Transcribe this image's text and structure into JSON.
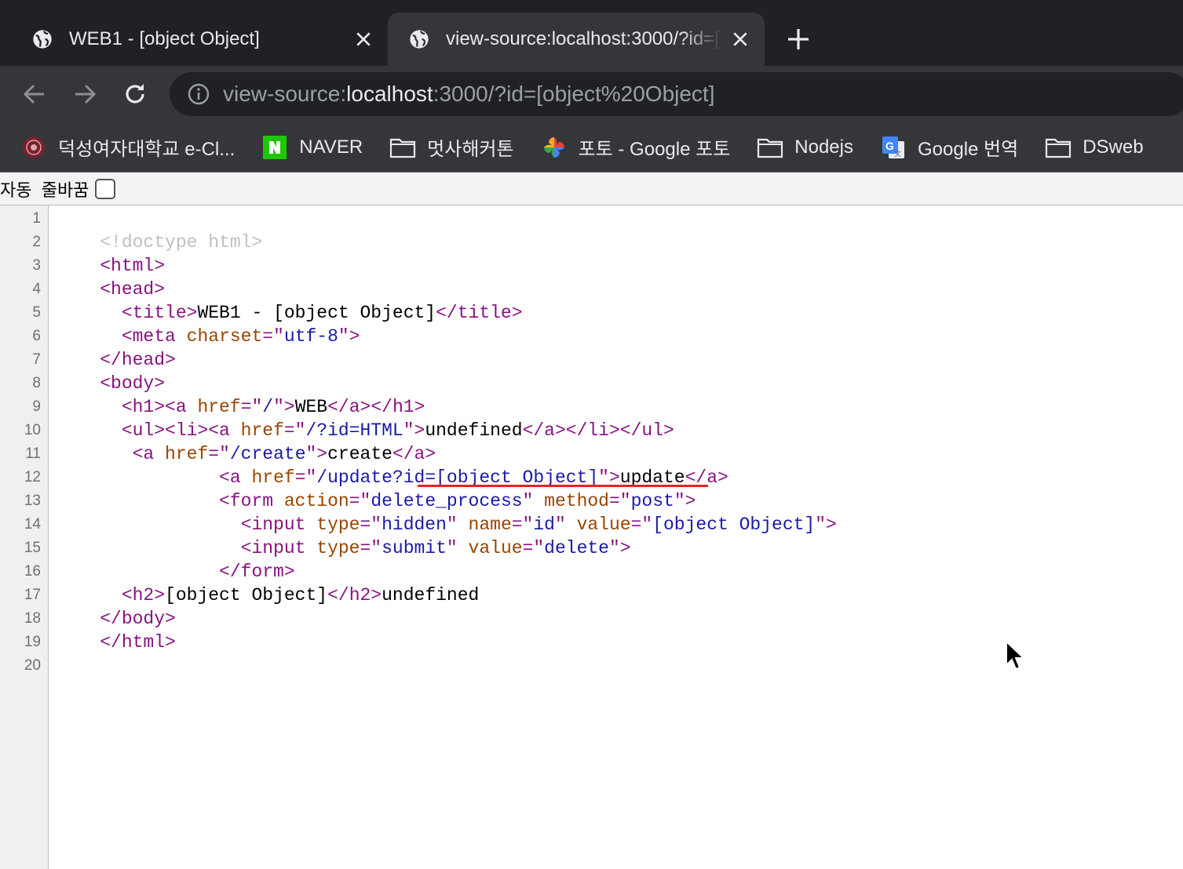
{
  "tabs": [
    {
      "title": "WEB1 - [object Object]",
      "active": false
    },
    {
      "title": "view-source:localhost:3000/?id=[object%20Object]",
      "active": true
    }
  ],
  "toolbar": {
    "url_prefix": "view-source:",
    "url_host": "localhost",
    "url_rest": ":3000/?id=[object%20Object]"
  },
  "bookmarks": [
    {
      "label": "덕성여자대학교 e-Cl...",
      "icon": "university-seal-icon"
    },
    {
      "label": "NAVER",
      "icon": "naver-icon"
    },
    {
      "label": "멋사해커톤",
      "icon": "folder-icon"
    },
    {
      "label": "포토 - Google 포토",
      "icon": "google-photos-icon"
    },
    {
      "label": "Nodejs",
      "icon": "folder-icon"
    },
    {
      "label": "Google 번역",
      "icon": "google-translate-icon"
    },
    {
      "label": "DSweb",
      "icon": "folder-icon"
    }
  ],
  "wrap": {
    "label": "자동  줄바꿈",
    "checked": false
  },
  "source": {
    "line_numbers": [
      "1",
      "2",
      "3",
      "4",
      "5",
      "6",
      "7",
      "8",
      "9",
      "10",
      "11",
      "12",
      "13",
      "14",
      "15",
      "16",
      "17",
      "18",
      "19",
      "20"
    ],
    "lines": [
      [],
      [
        [
          "doc",
          "    <!doctype html>"
        ]
      ],
      [
        [
          "txt",
          "    "
        ],
        [
          "tag",
          "<html>"
        ]
      ],
      [
        [
          "txt",
          "    "
        ],
        [
          "tag",
          "<head>"
        ]
      ],
      [
        [
          "txt",
          "      "
        ],
        [
          "tag",
          "<title>"
        ],
        [
          "txt",
          "WEB1 - [object Object]"
        ],
        [
          "tag",
          "</title>"
        ]
      ],
      [
        [
          "txt",
          "      "
        ],
        [
          "tag",
          "<meta "
        ],
        [
          "attr",
          "charset"
        ],
        [
          "tag",
          "=\""
        ],
        [
          "val",
          "utf-8"
        ],
        [
          "tag",
          "\">"
        ]
      ],
      [
        [
          "txt",
          "    "
        ],
        [
          "tag",
          "</head>"
        ]
      ],
      [
        [
          "txt",
          "    "
        ],
        [
          "tag",
          "<body>"
        ]
      ],
      [
        [
          "txt",
          "      "
        ],
        [
          "tag",
          "<h1><a "
        ],
        [
          "attr",
          "href"
        ],
        [
          "tag",
          "=\""
        ],
        [
          "val",
          "/"
        ],
        [
          "tag",
          "\">"
        ],
        [
          "txt",
          "WEB"
        ],
        [
          "tag",
          "</a></h1>"
        ]
      ],
      [
        [
          "txt",
          "      "
        ],
        [
          "tag",
          "<ul><li><a "
        ],
        [
          "attr",
          "href"
        ],
        [
          "tag",
          "=\""
        ],
        [
          "val",
          "/?id=HTML"
        ],
        [
          "tag",
          "\">"
        ],
        [
          "txt",
          "undefined"
        ],
        [
          "tag",
          "</a></li></ul>"
        ]
      ],
      [
        [
          "txt",
          "       "
        ],
        [
          "tag",
          "<a "
        ],
        [
          "attr",
          "href"
        ],
        [
          "tag",
          "=\""
        ],
        [
          "val",
          "/create"
        ],
        [
          "tag",
          "\">"
        ],
        [
          "txt",
          "create"
        ],
        [
          "tag",
          "</a>"
        ]
      ],
      [
        [
          "txt",
          "               "
        ],
        [
          "tag",
          "<a "
        ],
        [
          "attr",
          "href"
        ],
        [
          "tag",
          "=\""
        ],
        [
          "val",
          "/update?id=[object Object]"
        ],
        [
          "tag",
          "\">"
        ],
        [
          "txt",
          "update"
        ],
        [
          "tag",
          "</a>"
        ]
      ],
      [
        [
          "txt",
          "               "
        ],
        [
          "tag",
          "<form "
        ],
        [
          "attr",
          "action"
        ],
        [
          "tag",
          "=\""
        ],
        [
          "val",
          "delete_process"
        ],
        [
          "tag",
          "\" "
        ],
        [
          "attr",
          "method"
        ],
        [
          "tag",
          "=\""
        ],
        [
          "val",
          "post"
        ],
        [
          "tag",
          "\">"
        ]
      ],
      [
        [
          "txt",
          "                 "
        ],
        [
          "tag",
          "<input "
        ],
        [
          "attr",
          "type"
        ],
        [
          "tag",
          "=\""
        ],
        [
          "val",
          "hidden"
        ],
        [
          "tag",
          "\" "
        ],
        [
          "attr",
          "name"
        ],
        [
          "tag",
          "=\""
        ],
        [
          "val",
          "id"
        ],
        [
          "tag",
          "\" "
        ],
        [
          "attr",
          "value"
        ],
        [
          "tag",
          "=\""
        ],
        [
          "val",
          "[object Object]"
        ],
        [
          "tag",
          "\">"
        ]
      ],
      [
        [
          "txt",
          "                 "
        ],
        [
          "tag",
          "<input "
        ],
        [
          "attr",
          "type"
        ],
        [
          "tag",
          "=\""
        ],
        [
          "val",
          "submit"
        ],
        [
          "tag",
          "\" "
        ],
        [
          "attr",
          "value"
        ],
        [
          "tag",
          "=\""
        ],
        [
          "val",
          "delete"
        ],
        [
          "tag",
          "\">"
        ]
      ],
      [
        [
          "txt",
          "               "
        ],
        [
          "tag",
          "</form>"
        ]
      ],
      [
        [
          "txt",
          "      "
        ],
        [
          "tag",
          "<h2>"
        ],
        [
          "txt",
          "[object Object]"
        ],
        [
          "tag",
          "</h2>"
        ],
        [
          "txt",
          "undefined"
        ]
      ],
      [
        [
          "txt",
          "    "
        ],
        [
          "tag",
          "</body>"
        ]
      ],
      [
        [
          "txt",
          "    "
        ],
        [
          "tag",
          "</html>"
        ]
      ],
      []
    ]
  }
}
